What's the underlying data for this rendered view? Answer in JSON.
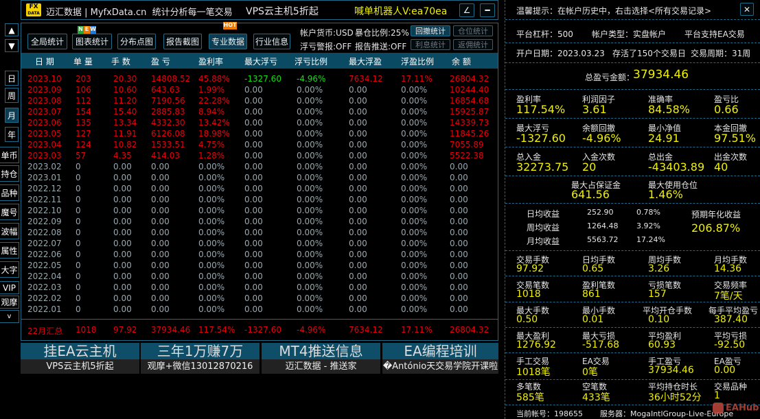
{
  "colors": {
    "accent": "#1d6c8a",
    "header_bg": "#0b4a63",
    "profit": "#e8000c",
    "loss": "#12e012",
    "value": "#f0f000"
  },
  "titlebar": {
    "logo": "FX DATA",
    "brand": "迈汇数据 | MyfxData.cn  统计分析每一笔交易",
    "promo": "VPS云主机5折起",
    "robot": "喊单机器人V:ea70ea",
    "btn1": "∠",
    "btn2": "━"
  },
  "toolbar": {
    "buttons": [
      "全局统计",
      "图表统计",
      "分布点图",
      "报告截图",
      "专业数据",
      "行业信息"
    ],
    "new_badge": [
      "N",
      "E",
      "W"
    ],
    "hot_badge": "HOT",
    "currency": "帐户货币:USD",
    "burst": "暴仓比例:25%",
    "float_alert": "浮亏警报:OFF",
    "report_push": "报告推送:OFF",
    "right_buttons": [
      "回撤统计",
      "仓位统计",
      "利息统计",
      "返佣统计"
    ]
  },
  "sidebar": {
    "up": "▲",
    "down": "▼",
    "periods": [
      "日",
      "周",
      "月",
      "年"
    ],
    "items": [
      "单币",
      "持仓",
      "品种",
      "魔号",
      "波幅",
      "属性",
      "大字",
      "VIP",
      "观摩",
      "v"
    ]
  },
  "table": {
    "headers": [
      "日 期",
      "单 量",
      "手 数",
      "盈 亏",
      "盈利率",
      "最大浮亏",
      "浮亏比例",
      "最大浮盈",
      "浮盈比例",
      "余 额"
    ],
    "rows": [
      [
        "2023.10",
        "203",
        "20.30",
        "14808.52",
        "45.88%",
        "-1327.60",
        "-4.96%",
        "7634.12",
        "17.11%",
        "26804.32"
      ],
      [
        "2023.09",
        "106",
        "10.60",
        "643.63",
        "1.99%",
        "0.00",
        "0.00%",
        "0.00",
        "0.00%",
        "10244.40"
      ],
      [
        "2023.08",
        "112",
        "11.20",
        "7190.56",
        "22.28%",
        "0.00",
        "0.00%",
        "0.00",
        "0.00%",
        "16854.68"
      ],
      [
        "2023.07",
        "154",
        "15.40",
        "2885.83",
        "8.94%",
        "0.00",
        "0.00%",
        "0.00",
        "0.00%",
        "15925.87"
      ],
      [
        "2023.06",
        "135",
        "13.34",
        "4332.30",
        "13.42%",
        "0.00",
        "0.00%",
        "0.00",
        "0.00%",
        "14339.73"
      ],
      [
        "2023.05",
        "127",
        "11.91",
        "6126.08",
        "18.98%",
        "0.00",
        "0.00%",
        "0.00",
        "0.00%",
        "11845.26"
      ],
      [
        "2023.04",
        "124",
        "10.82",
        "1533.51",
        "4.75%",
        "0.00",
        "0.00%",
        "0.00",
        "0.00%",
        "7055.89"
      ],
      [
        "2023.03",
        "57",
        "4.35",
        "414.03",
        "1.28%",
        "0.00",
        "0.00%",
        "0.00",
        "0.00%",
        "5522.38"
      ],
      [
        "2023.02",
        "0",
        "0.00",
        "0.00",
        "0.00%",
        "0.00",
        "0.00%",
        "0.00",
        "0.00%",
        "0.00"
      ],
      [
        "2023.01",
        "0",
        "0.00",
        "0.00",
        "0.00%",
        "0.00",
        "0.00%",
        "0.00",
        "0.00%",
        "0.00"
      ],
      [
        "2022.12",
        "0",
        "0.00",
        "0.00",
        "0.00%",
        "0.00",
        "0.00%",
        "0.00",
        "0.00%",
        "0.00"
      ],
      [
        "2022.11",
        "0",
        "0.00",
        "0.00",
        "0.00%",
        "0.00",
        "0.00%",
        "0.00",
        "0.00%",
        "0.00"
      ],
      [
        "2022.10",
        "0",
        "0.00",
        "0.00",
        "0.00%",
        "0.00",
        "0.00%",
        "0.00",
        "0.00%",
        "0.00"
      ],
      [
        "2022.09",
        "0",
        "0.00",
        "0.00",
        "0.00%",
        "0.00",
        "0.00%",
        "0.00",
        "0.00%",
        "0.00"
      ],
      [
        "2022.08",
        "0",
        "0.00",
        "0.00",
        "0.00%",
        "0.00",
        "0.00%",
        "0.00",
        "0.00%",
        "0.00"
      ],
      [
        "2022.07",
        "0",
        "0.00",
        "0.00",
        "0.00%",
        "0.00",
        "0.00%",
        "0.00",
        "0.00%",
        "0.00"
      ],
      [
        "2022.06",
        "0",
        "0.00",
        "0.00",
        "0.00%",
        "0.00",
        "0.00%",
        "0.00",
        "0.00%",
        "0.00"
      ],
      [
        "2022.05",
        "0",
        "0.00",
        "0.00",
        "0.00%",
        "0.00",
        "0.00%",
        "0.00",
        "0.00%",
        "0.00"
      ],
      [
        "2022.04",
        "0",
        "0.00",
        "0.00",
        "0.00%",
        "0.00",
        "0.00%",
        "0.00",
        "0.00%",
        "0.00"
      ],
      [
        "2022.03",
        "0",
        "0.00",
        "0.00",
        "0.00%",
        "0.00",
        "0.00%",
        "0.00",
        "0.00%",
        "0.00"
      ],
      [
        "2022.02",
        "0",
        "0.00",
        "0.00",
        "0.00%",
        "0.00",
        "0.00%",
        "0.00",
        "0.00%",
        "0.00"
      ],
      [
        "2022.01",
        "0",
        "0.00",
        "0.00",
        "0.00%",
        "0.00",
        "0.00%",
        "0.00",
        "0.00%",
        "0.00"
      ]
    ],
    "summary": [
      "22月汇总",
      "1018",
      "97.92",
      "37934.46",
      "117.54%",
      "-1327.60",
      "-4.96%",
      "7634.12",
      "17.11%",
      "26804.32"
    ]
  },
  "ads": [
    {
      "title": "挂EA云主机",
      "sub": "VPS云主机5折起"
    },
    {
      "title": "三年1万赚7万",
      "sub": "观摩+微信13012870216"
    },
    {
      "title": "MT4推送信息",
      "sub": "迈汇数据 - 推送家"
    },
    {
      "title": "EA编程培训",
      "sub": "�António天交易学院开课啦"
    }
  ],
  "panel": {
    "tip": "温馨提示：在帐户历史中，右击选择<所有交易记录>",
    "close": "✕",
    "leverage": "平台杠杆：500",
    "account_type": "帐户类型：实盘帐户",
    "ea_support": "平台支持EA交易",
    "open_date": "开户日期：2023.03.23",
    "alive": "存活了150个交易日",
    "period": "交易周期：31周",
    "total_label": "总盈亏金额：",
    "total_value": "37934.46",
    "grid1": [
      {
        "l": "盈利率",
        "v": "117.54%"
      },
      {
        "l": "利润因子",
        "v": "3.61"
      },
      {
        "l": "准确率",
        "v": "84.58%"
      },
      {
        "l": "盈亏比",
        "v": "0.66"
      },
      {
        "l": "最大浮亏",
        "v": "-1327.60"
      },
      {
        "l": "余额回撤",
        "v": "-4.96%"
      },
      {
        "l": "最小净值",
        "v": "24.91"
      },
      {
        "l": "本金回撤",
        "v": "97.51%"
      },
      {
        "l": "总入金",
        "v": "32273.75"
      },
      {
        "l": "入金次数",
        "v": "20"
      },
      {
        "l": "总出金",
        "v": "-43403.89"
      },
      {
        "l": "出金次数",
        "v": "40"
      }
    ],
    "margin": [
      {
        "l": "最大占保证金",
        "v": "641.56"
      },
      {
        "l": "最大使用仓位",
        "v": "1.46%"
      }
    ],
    "avg": [
      {
        "l": "日均收益",
        "v": "252.90",
        "p": "0.78%"
      },
      {
        "l": "周均收益",
        "v": "1264.48",
        "p": "3.92%"
      },
      {
        "l": "月均收益",
        "v": "5563.72",
        "p": "17.24%"
      }
    ],
    "annual_label": "预期年化收益",
    "annual_value": "206.87%",
    "grid2": [
      {
        "l": "交易手数",
        "v": "97.92"
      },
      {
        "l": "日均手数",
        "v": "0.65"
      },
      {
        "l": "周均手数",
        "v": "3.26"
      },
      {
        "l": "月均手数",
        "v": "14.36"
      },
      {
        "l": "交易笔数",
        "v": "1018"
      },
      {
        "l": "盈利笔数",
        "v": "861"
      },
      {
        "l": "亏损笔数",
        "v": "157"
      },
      {
        "l": "交易频率",
        "v": "7笔/天"
      },
      {
        "l": "最大手数",
        "v": "0.50"
      },
      {
        "l": "最小手数",
        "v": "0.01"
      },
      {
        "l": "平均开仓手数",
        "v": "0.10"
      },
      {
        "l": "每手平均盈亏",
        "v": "387.40"
      },
      {
        "l": "最大盈利",
        "v": "1276.92"
      },
      {
        "l": "最大亏损",
        "v": "-517.68"
      },
      {
        "l": "平均盈利",
        "v": "60.93"
      },
      {
        "l": "平均亏损",
        "v": "-92.50"
      },
      {
        "l": "手工交易",
        "v": "1018笔"
      },
      {
        "l": "EA交易",
        "v": "0笔"
      },
      {
        "l": "手工盈亏",
        "v": "37934.46"
      },
      {
        "l": "EA盈亏",
        "v": "0.00"
      },
      {
        "l": "多笔数",
        "v": "585笔"
      },
      {
        "l": "空笔数",
        "v": "433笔"
      },
      {
        "l": "平均持仓时长",
        "v": "36小时52分"
      },
      {
        "l": "交易品种",
        "v": "1"
      }
    ],
    "account": "当前帐号：198655",
    "server": "服务器：MogaIntlGroup-Live-Europe",
    "watermark": "EAHub"
  }
}
